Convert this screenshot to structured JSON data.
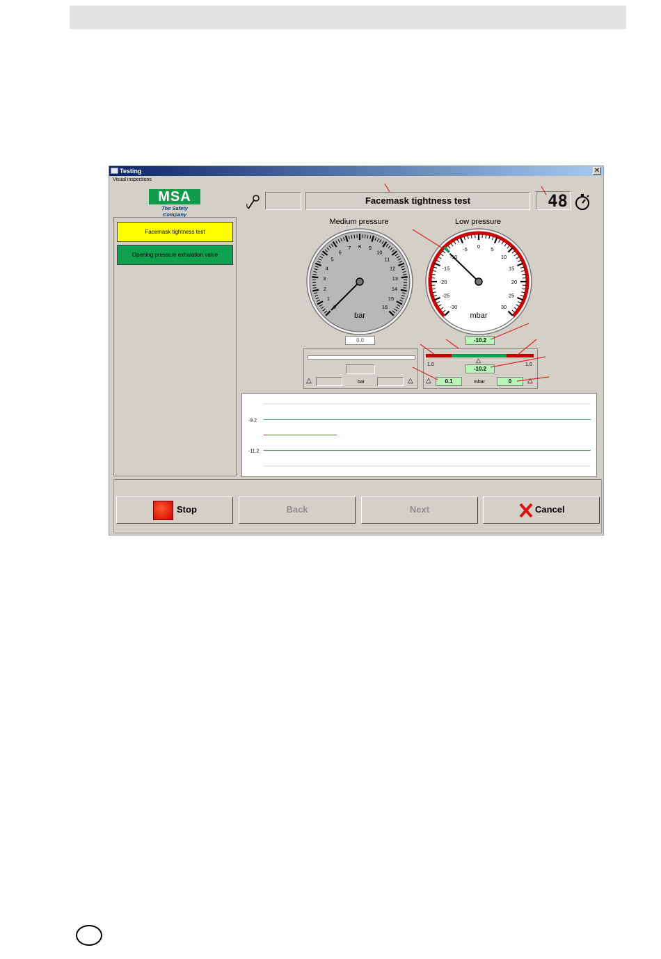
{
  "window": {
    "title": "Testing",
    "menu": [
      "Visual inspections"
    ]
  },
  "logo": {
    "text": "MSA",
    "tagline": "The Safety Company"
  },
  "header": {
    "test_title": "Facemask tightness test",
    "timer": "48"
  },
  "steps": [
    {
      "label": "Facemask tightness test",
      "color": "#ffff00"
    },
    {
      "label": "Opening pressure exhalation valve",
      "color": "#10a050"
    }
  ],
  "medium_gauge": {
    "title": "Medium pressure",
    "unit": "bar",
    "ticks": [
      "0",
      "1",
      "2",
      "3",
      "4",
      "5",
      "6",
      "7",
      "8",
      "9",
      "10",
      "11",
      "12",
      "13",
      "14",
      "15",
      "16"
    ],
    "needle_value": 0,
    "reading": "0.0",
    "panel_unit": "bar"
  },
  "low_gauge": {
    "title": "Low pressure",
    "unit": "mbar",
    "ticks": [
      "-30",
      "-25",
      "-20",
      "-15",
      "-10",
      "-5",
      "0",
      "5",
      "10",
      "15",
      "20",
      "25",
      "30"
    ],
    "needle_value": -10.2,
    "reading": "-10.2",
    "bar_reading": "-10.2",
    "left_limit": "1.0",
    "right_limit": "1.0",
    "delta_left": "0.1",
    "delta_right": "0",
    "panel_unit": "mbar"
  },
  "chart_data": {
    "type": "line",
    "y_labels": [
      "-9.2",
      "-11.2"
    ],
    "series": [
      {
        "values": [
          -9.2,
          -9.2
        ],
        "color": "#2e8b57"
      },
      {
        "values": [
          -11.2,
          -11.2
        ],
        "color": "#1a6e3a"
      },
      {
        "values": [
          -10.2,
          -10.2
        ],
        "color": "#e03030"
      }
    ]
  },
  "buttons": {
    "stop": "Stop",
    "back": "Back",
    "next": "Next",
    "cancel": "Cancel"
  },
  "colors": {
    "accent_green": "#10a050",
    "highlight_yellow": "#ffff00",
    "warning_red": "#d00000"
  }
}
